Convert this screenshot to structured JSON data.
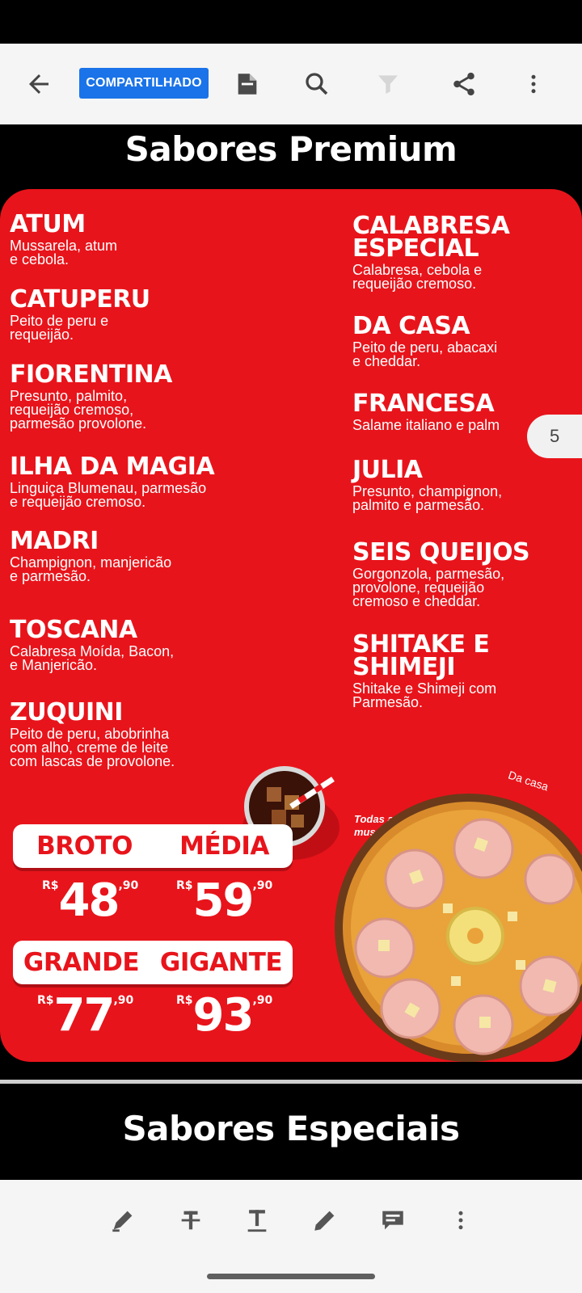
{
  "toolbar": {
    "shared_label": "COMPARTILHADO",
    "icons": [
      "back-arrow-icon",
      "reading-mode-icon",
      "search-icon",
      "filter-icon",
      "share-icon",
      "more-vert-icon"
    ]
  },
  "document": {
    "section1_title": "Sabores Premium",
    "section2_title": "Sabores Especiais",
    "page_number": "5",
    "left_flavors": [
      {
        "name": "ATUM",
        "desc": "Mussarela, atum\ne cebola."
      },
      {
        "name": "CATUPERU",
        "desc": "Peito de peru e\nrequeijão."
      },
      {
        "name": "FIORENTINA",
        "desc": "Presunto, palmito,\nrequeijão cremoso,\nparmesão provolone."
      },
      {
        "name": "ILHA DA MAGIA",
        "desc": "Linguiça Blumenau, parmesão\ne requeijão cremoso."
      },
      {
        "name": "MADRI",
        "desc": "Champignon, manjericão\ne parmesão."
      },
      {
        "name": "TOSCANA",
        "desc": "Calabresa Moída, Bacon,\ne Manjericão."
      },
      {
        "name": "ZUQUINI",
        "desc": "Peito de peru, abobrinha\ncom alho, creme de leite\ncom lascas de provolone."
      }
    ],
    "right_flavors": [
      {
        "name": "CALABRESA\nESPECIAL",
        "desc": "Calabresa, cebola e\nrequeijão cremoso."
      },
      {
        "name": "DA CASA",
        "desc": "Peito de peru, abacaxi\ne cheddar."
      },
      {
        "name": "FRANCESA",
        "desc": "Salame italiano e palm"
      },
      {
        "name": "JULIA",
        "desc": "Presunto, champignon,\npalmito e parmesão."
      },
      {
        "name": "SEIS QUEIJOS",
        "desc": "Gorgonzola, parmesão,\nprovolone, requeijão\ncremoso e cheddar."
      },
      {
        "name": "SHITAKE E\nSHIMEJI",
        "desc": "Shitake e Shimeji com\nParmesão."
      }
    ],
    "note": "Todas as pizzas contém orégano, mussarela e azeitonas.",
    "pizza_label": "Da casa",
    "sizes_row1": [
      "BROTO",
      "MÉDIA"
    ],
    "sizes_row2": [
      "GRANDE",
      "GIGANTE"
    ],
    "currency": "R$",
    "prices": [
      {
        "int": "48",
        "cents": ",90"
      },
      {
        "int": "59",
        "cents": ",90"
      },
      {
        "int": "77",
        "cents": ",90"
      },
      {
        "int": "93",
        "cents": ",90"
      }
    ]
  },
  "bottom_toolbar": {
    "icons": [
      "highlighter-icon",
      "strikethrough-icon",
      "text-icon",
      "pen-icon",
      "comment-icon",
      "more-vert-icon"
    ]
  },
  "colors": {
    "menu_red": "#e8141b",
    "badge_blue": "#1a73e8"
  }
}
